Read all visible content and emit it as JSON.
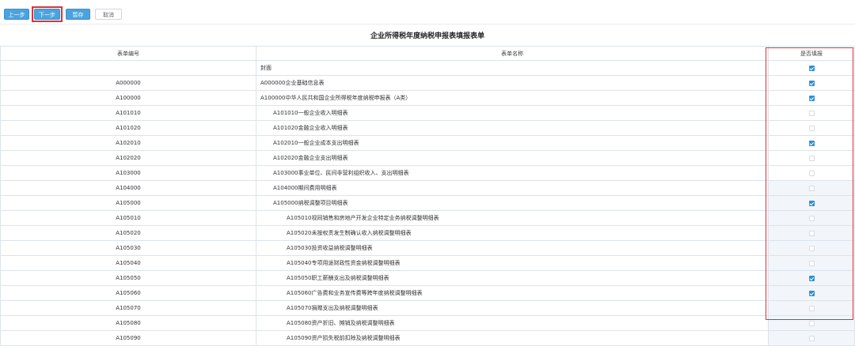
{
  "toolbar": {
    "prev_label": "上一步",
    "next_label": "下一步",
    "save_label": "暂存",
    "cancel_label": "取消"
  },
  "title": "企业所得税年度纳税申报表填报表单",
  "columns": {
    "code": "表单编号",
    "name": "表单名称",
    "fill": "是否填报"
  },
  "rows": [
    {
      "code": "",
      "name": "封面",
      "level": 0,
      "checked": true
    },
    {
      "code": "A000000",
      "name": "A000000企业基础信息表",
      "level": 0,
      "checked": true
    },
    {
      "code": "A100000",
      "name": "A100000中华人民共和国企业所得税年度纳税申报表（A类）",
      "level": 0,
      "checked": true
    },
    {
      "code": "A101010",
      "name": "A101010一般企业收入明细表",
      "level": 1,
      "checked": false
    },
    {
      "code": "A101020",
      "name": "A101020金融企业收入明细表",
      "level": 1,
      "checked": false
    },
    {
      "code": "A102010",
      "name": "A102010一般企业成本支出明细表",
      "level": 1,
      "checked": true
    },
    {
      "code": "A102020",
      "name": "A102020金融企业支出明细表",
      "level": 1,
      "checked": false
    },
    {
      "code": "A103000",
      "name": "A103000事业单位、民间非营利组织收入、支出明细表",
      "level": 1,
      "checked": false
    },
    {
      "code": "A104000",
      "name": "A104000期间费用明细表",
      "level": 1,
      "checked": false
    },
    {
      "code": "A105000",
      "name": "A105000纳税调整项目明细表",
      "level": 1,
      "checked": true
    },
    {
      "code": "A105010",
      "name": "A105010视同销售和房地产开发企业特定业务纳税调整明细表",
      "level": 2,
      "checked": false
    },
    {
      "code": "A105020",
      "name": "A105020未按权责发生制确认收入纳税调整明细表",
      "level": 2,
      "checked": false
    },
    {
      "code": "A105030",
      "name": "A105030投资收益纳税调整明细表",
      "level": 2,
      "checked": false
    },
    {
      "code": "A105040",
      "name": "A105040专项用途财政性资金纳税调整明细表",
      "level": 2,
      "checked": false
    },
    {
      "code": "A105050",
      "name": "A105050职工薪酬支出及纳税调整明细表",
      "level": 2,
      "checked": true
    },
    {
      "code": "A105060",
      "name": "A105060广告费和业务宣传费等跨年度纳税调整明细表",
      "level": 2,
      "checked": true
    },
    {
      "code": "A105070",
      "name": "A105070捐赠支出及纳税调整明细表",
      "level": 2,
      "checked": false
    },
    {
      "code": "A105080",
      "name": "A105080资产折旧、摊销及纳税调整明细表",
      "level": 2,
      "checked": false
    },
    {
      "code": "A105090",
      "name": "A105090资产损失税前扣除及纳税调整明细表",
      "level": 2,
      "checked": false
    }
  ]
}
